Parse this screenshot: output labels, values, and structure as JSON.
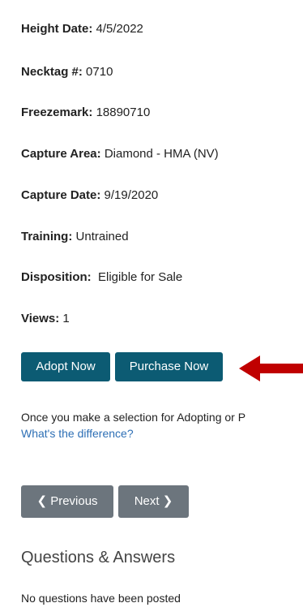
{
  "fields": [
    {
      "label": "Height Date:",
      "value": "4/5/2022"
    },
    {
      "label": "Necktag #:",
      "value": "0710"
    },
    {
      "label": "Freezemark:",
      "value": "18890710"
    },
    {
      "label": "Capture Area:",
      "value": "Diamond - HMA (NV)"
    },
    {
      "label": "Capture Date:",
      "value": "9/19/2020"
    },
    {
      "label": "Training:",
      "value": "Untrained"
    },
    {
      "label": "Disposition:",
      "value": " Eligible for Sale"
    },
    {
      "label": "Views:",
      "value": "1"
    }
  ],
  "actions": {
    "adopt_label": "Adopt Now",
    "purchase_label": "Purchase Now"
  },
  "note": {
    "text": "Once you make a selection for Adopting or P",
    "link": "What's the difference?"
  },
  "pager": {
    "previous_label": "Previous",
    "next_label": "Next"
  },
  "qa": {
    "title": "Questions & Answers",
    "empty_text": "No questions have been posted"
  },
  "colors": {
    "primary_button": "#0c5b73",
    "secondary_button": "#6c757d",
    "arrow": "#c00000",
    "link": "#2d6fb5"
  },
  "icons": {
    "previous": "chevron-left-icon",
    "next": "chevron-right-icon",
    "pointer": "arrow-left-icon"
  }
}
